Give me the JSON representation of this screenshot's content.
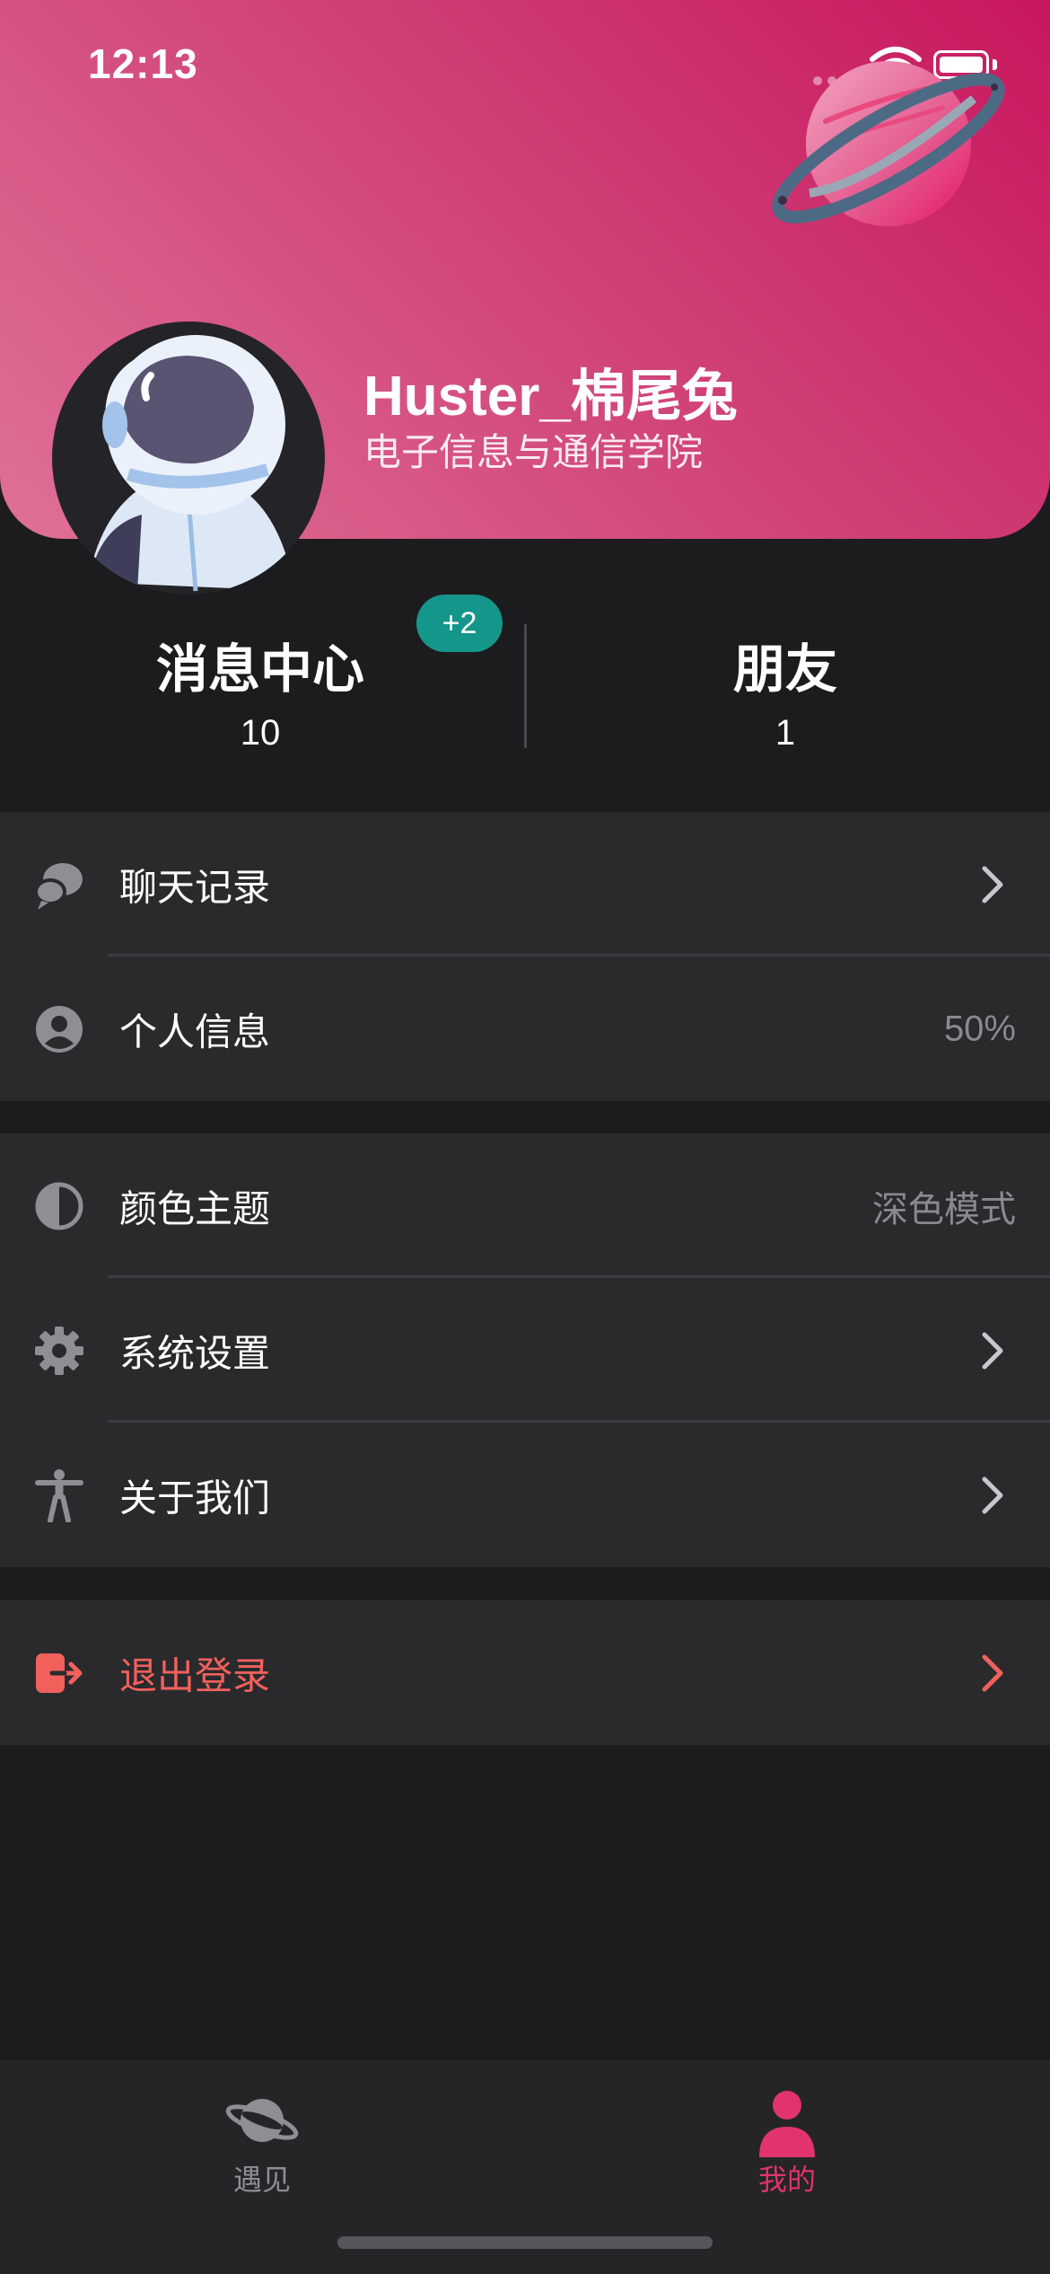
{
  "status_bar": {
    "time": "12:13"
  },
  "profile": {
    "username": "Huster_棉尾兔",
    "school": "电子信息与通信学院"
  },
  "stats": {
    "messages": {
      "label": "消息中心",
      "value": "10",
      "badge": "+2"
    },
    "friends": {
      "label": "朋友",
      "value": "1"
    }
  },
  "menu": {
    "chat_history": {
      "label": "聊天记录"
    },
    "personal_info": {
      "label": "个人信息",
      "value": "50%"
    },
    "color_theme": {
      "label": "颜色主题",
      "value": "深色模式"
    },
    "system_settings": {
      "label": "系统设置"
    },
    "about_us": {
      "label": "关于我们"
    },
    "logout": {
      "label": "退出登录"
    }
  },
  "tabbar": {
    "tabs": [
      {
        "label": "遇见",
        "icon": "planet-icon",
        "active": false
      },
      {
        "label": "我的",
        "icon": "person-icon",
        "active": true
      }
    ]
  },
  "colors": {
    "header_gradient": [
      "#c8175f",
      "#df7096"
    ],
    "accent": "#e0336f",
    "badge": "#15968a",
    "danger": "#f2605c",
    "background": "#1c1c1e",
    "cell": "#2a2a2d"
  }
}
